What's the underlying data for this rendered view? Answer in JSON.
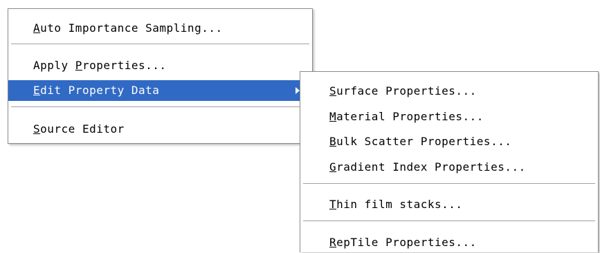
{
  "main_menu": {
    "items": [
      {
        "mnemonic": "A",
        "rest": "uto Importance Sampling..."
      },
      {
        "prefix": "Apply ",
        "mnemonic": "P",
        "rest": "roperties..."
      },
      {
        "mnemonic": "E",
        "rest": "dit Property Data",
        "highlighted": true,
        "has_submenu": true
      },
      {
        "mnemonic": "S",
        "rest": "ource Editor"
      }
    ]
  },
  "sub_menu": {
    "items": [
      {
        "mnemonic": "S",
        "rest": "urface Properties..."
      },
      {
        "mnemonic": "M",
        "rest": "aterial Properties..."
      },
      {
        "mnemonic": "B",
        "rest": "ulk Scatter Properties..."
      },
      {
        "mnemonic": "G",
        "rest": "radient Index Properties..."
      },
      {
        "mnemonic": "T",
        "rest": "hin film stacks..."
      },
      {
        "mnemonic": "R",
        "rest": "epTile Properties..."
      }
    ]
  },
  "colors": {
    "highlight": "#316ac5",
    "highlight_text": "#ffffff",
    "text": "#000000",
    "separator": "#a0a0a0"
  }
}
